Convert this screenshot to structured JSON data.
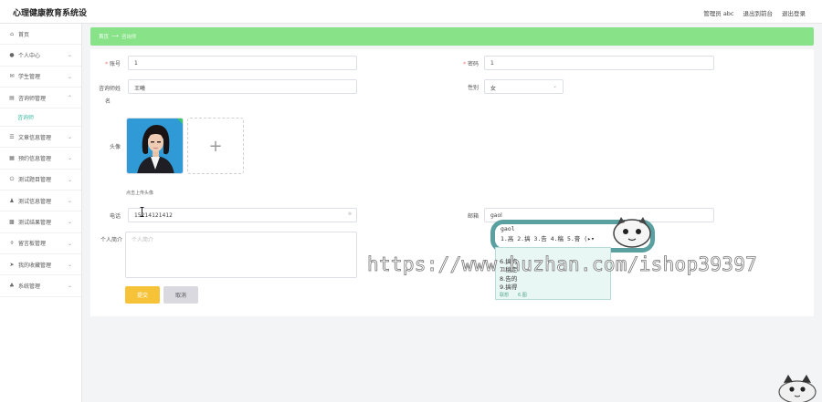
{
  "header": {
    "title": "心理健康教育系统设",
    "links": [
      "管理员 abc",
      "退出到前台",
      "退出登录"
    ]
  },
  "sidebar": {
    "items": [
      {
        "label": "首页",
        "icon": "home-icon",
        "glyph": "⌂",
        "chevron": false
      },
      {
        "label": "个人中心",
        "icon": "user-icon",
        "glyph": "●",
        "chevron": true
      },
      {
        "label": "学生管理",
        "icon": "mail-icon",
        "glyph": "✉",
        "chevron": true
      },
      {
        "label": "咨询师管理",
        "icon": "list-icon",
        "glyph": "▤",
        "chevron": true,
        "sub": [
          "咨询师"
        ]
      },
      {
        "label": "文章信息管理",
        "icon": "menu-icon",
        "glyph": "☰",
        "chevron": true
      },
      {
        "label": "预约信息管理",
        "icon": "calendar-icon",
        "glyph": "▦",
        "chevron": true
      },
      {
        "label": "测试题目管理",
        "icon": "power-icon",
        "glyph": "⏻",
        "chevron": true
      },
      {
        "label": "测试信息管理",
        "icon": "person-icon",
        "glyph": "♟",
        "chevron": true
      },
      {
        "label": "测试结果管理",
        "icon": "grid-icon",
        "glyph": "▩",
        "chevron": true
      },
      {
        "label": "留言板管理",
        "icon": "mic-icon",
        "glyph": "⌽",
        "chevron": true
      },
      {
        "label": "我的收藏管理",
        "icon": "send-icon",
        "glyph": "➤",
        "chevron": true
      },
      {
        "label": "系统管理",
        "icon": "users-icon",
        "glyph": "♣",
        "chevron": true
      }
    ]
  },
  "breadcrumb": {
    "home": "首页",
    "separator": "⟶",
    "current": "咨询师"
  },
  "form": {
    "account_label": "账号",
    "account_value": "1",
    "password_label": "密码",
    "password_value": "1",
    "name_label_line1": "咨询师姓",
    "name_label_line2": "名",
    "name_value": "王曦",
    "gender_label": "性别",
    "gender_value": "女",
    "avatar_label": "头像",
    "upload_plus": "+",
    "upload_tip": "点击上传头像",
    "phone_label": "电话",
    "phone_value": "15214121412",
    "email_label": "邮箱",
    "email_value": "gaol",
    "intro_label": "个人简介",
    "intro_placeholder": "个人简介",
    "submit_label": "提交",
    "cancel_label": "取消"
  },
  "ime": {
    "composition": "gaol",
    "line2": "1.高 2.搞 3.告 4.稿 5.膏 ⟨▸▾",
    "candidates": [
      "1.高",
      "6.搞的",
      "7.稿定",
      "8.告的",
      "9.搞得"
    ],
    "footer": [
      "联想",
      "6.图"
    ]
  },
  "watermark": "https://www.huzhan.com/ishop39397",
  "colors": {
    "breadcrumb_bg": "#88e388",
    "submit_bg": "#f6c338",
    "cancel_bg": "#d9d9df",
    "active_sub": "#3fb8a0"
  }
}
